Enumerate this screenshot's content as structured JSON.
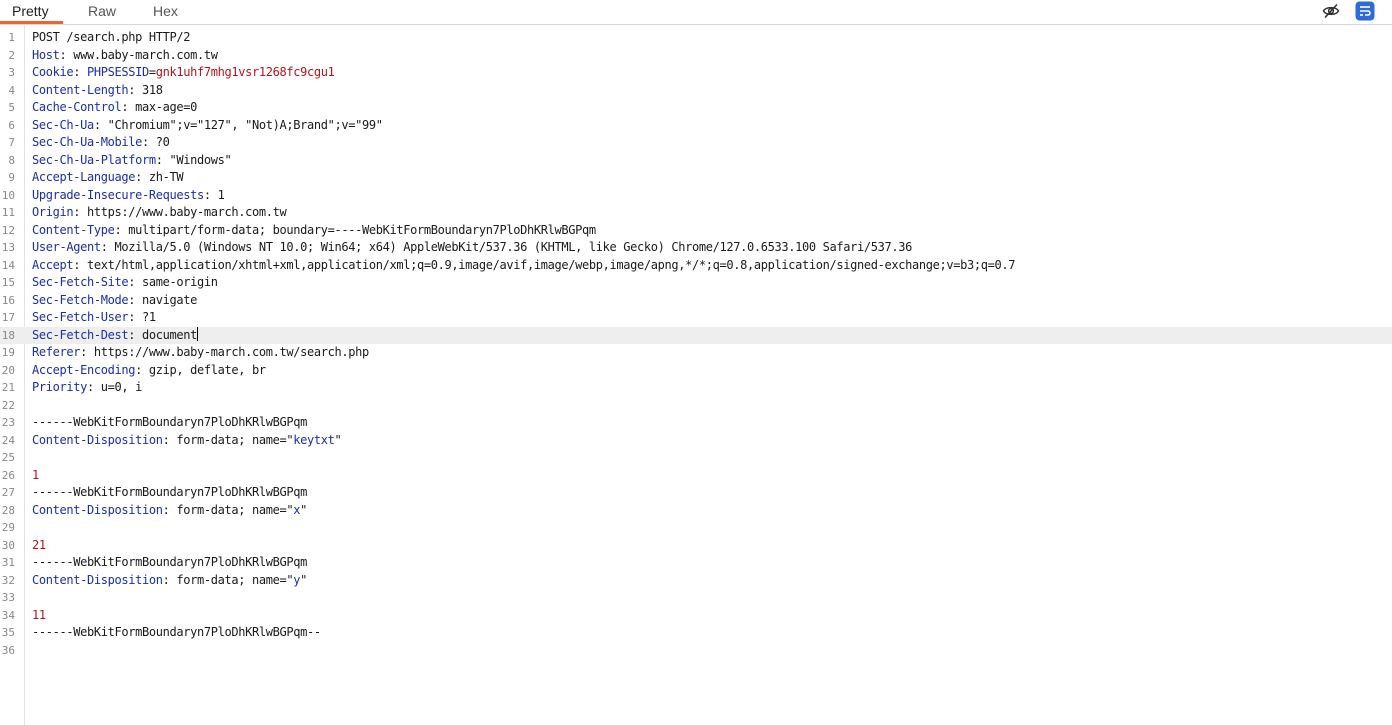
{
  "tabs": [
    {
      "label": "Pretty",
      "active": true
    },
    {
      "label": "Raw",
      "active": false
    },
    {
      "label": "Hex",
      "active": false
    }
  ],
  "toolbar": {
    "hide_icon": "eye-slash-icon",
    "wrap_icon": "text-wrap-icon",
    "accent_color": "#2f6bd8",
    "tab_accent_color": "#e8672e"
  },
  "request": {
    "current_line": 18,
    "lines": [
      {
        "n": "1",
        "text": "POST /search.php HTTP/2"
      },
      {
        "n": "2",
        "name": "Host",
        "sep": ": ",
        "value": "www.baby-march.com.tw"
      },
      {
        "n": "3",
        "name": "Cookie",
        "sep": ": ",
        "cookie_name": "PHPSESSID",
        "cookie_sep": "=",
        "cookie_value": "gnk1uhf7mhg1vsr1268fc9cgu1"
      },
      {
        "n": "4",
        "name": "Content-Length",
        "sep": ": ",
        "value": "318"
      },
      {
        "n": "5",
        "name": "Cache-Control",
        "sep": ": ",
        "value": "max-age=0"
      },
      {
        "n": "6",
        "name": "Sec-Ch-Ua",
        "sep": ": ",
        "value": "\"Chromium\";v=\"127\", \"Not)A;Brand\";v=\"99\""
      },
      {
        "n": "7",
        "name": "Sec-Ch-Ua-Mobile",
        "sep": ": ",
        "value": "?0"
      },
      {
        "n": "8",
        "name": "Sec-Ch-Ua-Platform",
        "sep": ": ",
        "value": "\"Windows\""
      },
      {
        "n": "9",
        "name": "Accept-Language",
        "sep": ": ",
        "value": "zh-TW"
      },
      {
        "n": "10",
        "name": "Upgrade-Insecure-Requests",
        "sep": ": ",
        "value": "1"
      },
      {
        "n": "11",
        "name": "Origin",
        "sep": ": ",
        "value": "https://www.baby-march.com.tw"
      },
      {
        "n": "12",
        "name": "Content-Type",
        "sep": ": ",
        "value": "multipart/form-data; boundary=----WebKitFormBoundaryn7PloDhKRlwBGPqm"
      },
      {
        "n": "13",
        "name": "User-Agent",
        "sep": ": ",
        "value": "Mozilla/5.0 (Windows NT 10.0; Win64; x64) AppleWebKit/537.36 (KHTML, like Gecko) Chrome/127.0.6533.100 Safari/537.36"
      },
      {
        "n": "14",
        "name": "Accept",
        "sep": ": ",
        "value": "text/html,application/xhtml+xml,application/xml;q=0.9,image/avif,image/webp,image/apng,*/*;q=0.8,application/signed-exchange;v=b3;q=0.7"
      },
      {
        "n": "15",
        "name": "Sec-Fetch-Site",
        "sep": ": ",
        "value": "same-origin"
      },
      {
        "n": "16",
        "name": "Sec-Fetch-Mode",
        "sep": ": ",
        "value": "navigate"
      },
      {
        "n": "17",
        "name": "Sec-Fetch-User",
        "sep": ": ",
        "value": "?1"
      },
      {
        "n": "18",
        "name": "Sec-Fetch-Dest",
        "sep": ": ",
        "value": "document"
      },
      {
        "n": "19",
        "name": "Referer",
        "sep": ": ",
        "value": "https://www.baby-march.com.tw/search.php"
      },
      {
        "n": "20",
        "name": "Accept-Encoding",
        "sep": ": ",
        "value": "gzip, deflate, br"
      },
      {
        "n": "21",
        "name": "Priority",
        "sep": ": ",
        "value": "u=0, i"
      },
      {
        "n": "22",
        "text": ""
      },
      {
        "n": "23",
        "text": "------WebKitFormBoundaryn7PloDhKRlwBGPqm"
      },
      {
        "n": "24",
        "name": "Content-Disposition",
        "sep": ": ",
        "pre": "form-data; name=\"",
        "param": "keytxt",
        "post": "\""
      },
      {
        "n": "25",
        "text": ""
      },
      {
        "n": "26",
        "body_value": "1"
      },
      {
        "n": "27",
        "text": "------WebKitFormBoundaryn7PloDhKRlwBGPqm"
      },
      {
        "n": "28",
        "name": "Content-Disposition",
        "sep": ": ",
        "pre": "form-data; name=\"",
        "param": "x",
        "post": "\""
      },
      {
        "n": "29",
        "text": ""
      },
      {
        "n": "30",
        "body_value": "21"
      },
      {
        "n": "31",
        "text": "------WebKitFormBoundaryn7PloDhKRlwBGPqm"
      },
      {
        "n": "32",
        "name": "Content-Disposition",
        "sep": ": ",
        "pre": "form-data; name=\"",
        "param": "y",
        "post": "\""
      },
      {
        "n": "33",
        "text": ""
      },
      {
        "n": "34",
        "body_value": "11"
      },
      {
        "n": "35",
        "text": "------WebKitFormBoundaryn7PloDhKRlwBGPqm--"
      },
      {
        "n": "36",
        "text": ""
      }
    ]
  }
}
